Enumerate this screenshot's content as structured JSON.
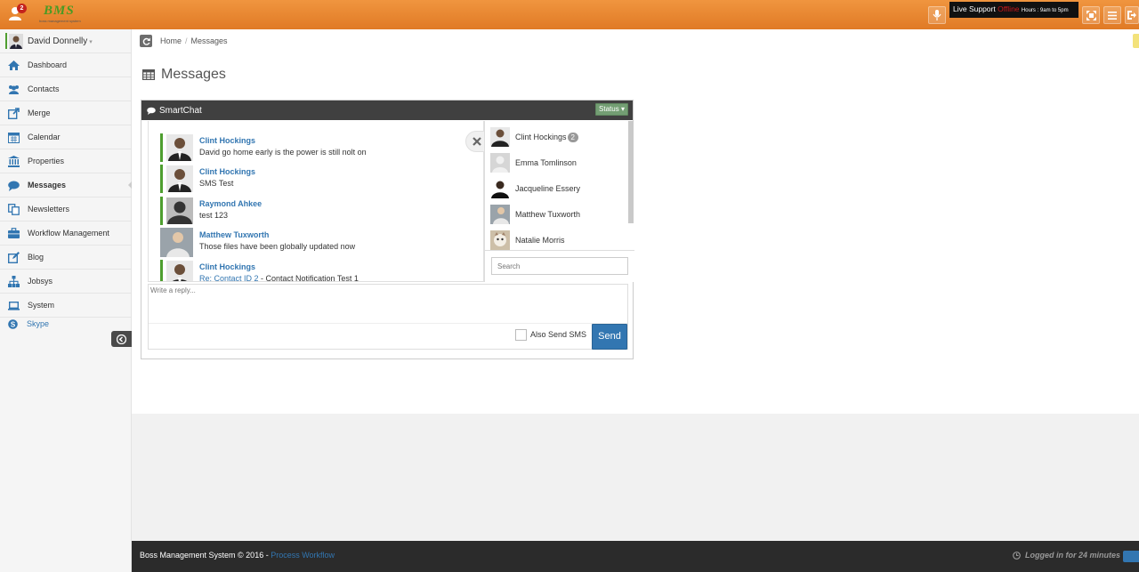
{
  "header": {
    "notification_count": "2",
    "logo": {
      "mark": "BMS",
      "subtitle": "boss management system"
    },
    "live_support": {
      "label": "Live Support",
      "status": "Offline",
      "hours": "Hours : 9am to 5pm"
    },
    "icons": [
      "microphone-icon",
      "fullscreen-icon",
      "menu-icon",
      "logout-icon"
    ]
  },
  "sidebar": {
    "user_name": "David Donnelly",
    "items": [
      {
        "label": "Dashboard",
        "icon": "home-icon"
      },
      {
        "label": "Contacts",
        "icon": "users-icon"
      },
      {
        "label": "Merge",
        "icon": "external-link-icon"
      },
      {
        "label": "Calendar",
        "icon": "calendar-icon"
      },
      {
        "label": "Properties",
        "icon": "bank-icon"
      },
      {
        "label": "Messages",
        "icon": "comment-icon",
        "active": true
      },
      {
        "label": "Newsletters",
        "icon": "copy-icon"
      },
      {
        "label": "Workflow Management",
        "icon": "briefcase-icon"
      },
      {
        "label": "Blog",
        "icon": "edit-icon"
      },
      {
        "label": "Jobsys",
        "icon": "sitemap-icon"
      },
      {
        "label": "System",
        "icon": "laptop-icon"
      }
    ],
    "skype": "Skype"
  },
  "breadcrumb": {
    "home": "Home",
    "current": "Messages"
  },
  "page": {
    "title": "Messages"
  },
  "smartchat": {
    "title": "SmartChat",
    "status_button": "Status",
    "messages": [
      {
        "name": "Clint Hockings",
        "text": "David go home early is the power is still nolt on"
      },
      {
        "name": "Clint Hockings",
        "text": "SMS Test"
      },
      {
        "name": "Raymond Ahkee",
        "text": "test 123"
      },
      {
        "name": "Matthew Tuxworth",
        "text": "Those files have been globally updated now"
      },
      {
        "name": "Clint Hockings",
        "link": "Re: Contact ID 2",
        "text": " - Contact Notification Test 1"
      }
    ],
    "users": [
      {
        "name": "Clint Hockings",
        "count": "2"
      },
      {
        "name": "Emma Tomlinson"
      },
      {
        "name": "Jacqueline Essery"
      },
      {
        "name": "Matthew Tuxworth"
      },
      {
        "name": "Natalie Morris"
      }
    ],
    "search_placeholder": "Search",
    "reply_placeholder": "Write a reply...",
    "sms_label": "Also Send SMS",
    "send_label": "Send"
  },
  "footer": {
    "copyright": "Boss Management System © 2016 - ",
    "link": "Process Workflow",
    "logged_in": "Logged in for 24 minutes"
  }
}
